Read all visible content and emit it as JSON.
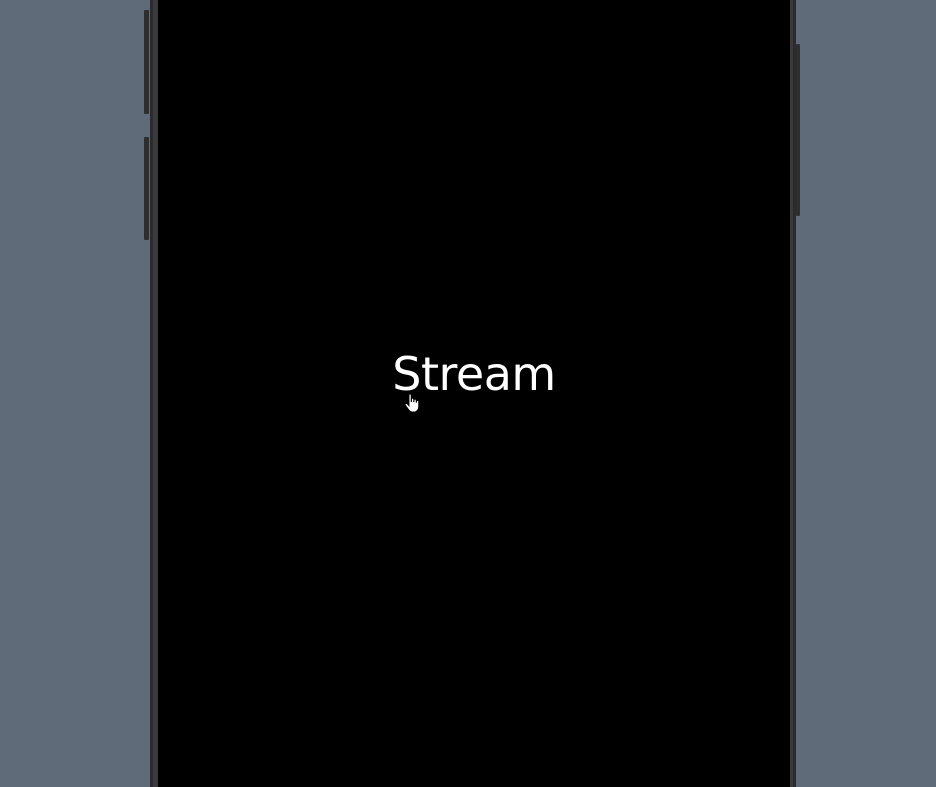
{
  "screen": {
    "title": "Stream"
  },
  "colors": {
    "background": "#5f6b79",
    "screen": "#000000",
    "frame": "#2b2b2d",
    "text": "#ffffff"
  },
  "cursor": {
    "icon": "hand-pointer-icon"
  }
}
